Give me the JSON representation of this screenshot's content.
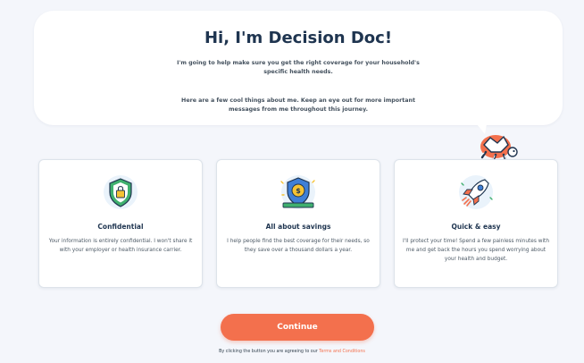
{
  "header": {
    "title": "Hi, I'm Decision Doc!",
    "intro_1": "I'm going to help make sure you get the right coverage for your household's specific health needs.",
    "intro_2": "Here are a few cool things about me. Keep an eye out for more important messages from me throughout this journey."
  },
  "cards": [
    {
      "icon": "shield-lock-icon",
      "title": "Confidential",
      "text": "Your information is entirely confidential. I won't share it with your employer or health insurance carrier."
    },
    {
      "icon": "savings-shield-icon",
      "title": "All about savings",
      "text": "I help people find the best coverage for their needs, so they save over a thousand dollars a year."
    },
    {
      "icon": "rocket-icon",
      "title": "Quick & easy",
      "text": "I'll protect your time! Spend a few painless minutes with me and get back the hours you spend worrying about your health and budget."
    }
  ],
  "actions": {
    "continue_label": "Continue",
    "consent_prefix": "By clicking the button you are agreeing to our",
    "terms_link": "Terms and Conditions"
  },
  "colors": {
    "accent": "#f3704d",
    "heading": "#1f3550",
    "background": "#f4f6fb"
  }
}
